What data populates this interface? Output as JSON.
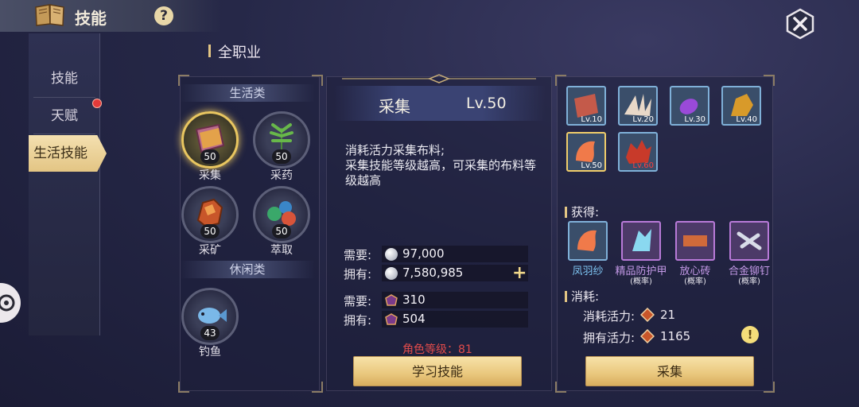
{
  "header": {
    "title": "技能",
    "help_glyph": "?"
  },
  "nav": {
    "items": [
      {
        "label": "技能",
        "has_badge": false
      },
      {
        "label": "天赋",
        "has_badge": true
      },
      {
        "label": "生活技能",
        "active": true
      }
    ]
  },
  "section_title": "全职业",
  "categories": {
    "life": {
      "header": "生活类",
      "skills": [
        {
          "name": "采集",
          "level": "50",
          "icon": "fabric-book-icon",
          "selected": true
        },
        {
          "name": "采药",
          "level": "50",
          "icon": "herb-icon"
        },
        {
          "name": "采矿",
          "level": "50",
          "icon": "ore-icon"
        },
        {
          "name": "萃取",
          "level": "50",
          "icon": "extract-icon"
        }
      ]
    },
    "leisure": {
      "header": "休闲类",
      "skills": [
        {
          "name": "钓鱼",
          "level": "43",
          "icon": "fish-icon"
        }
      ]
    }
  },
  "detail": {
    "name": "采集",
    "level": "Lv.50",
    "description": "消耗活力采集布料;\n采集技能等级越高，可采集的布料等级越高",
    "requirements": [
      {
        "label": "需要:",
        "value": "97,000",
        "icon": "silver-coin-icon"
      },
      {
        "label": "拥有:",
        "value": "7,580,985",
        "icon": "silver-coin-icon",
        "plus": "+"
      },
      {
        "label": "需要:",
        "value": "310",
        "icon": "skill-point-icon"
      },
      {
        "label": "拥有:",
        "value": "504",
        "icon": "skill-point-icon"
      }
    ],
    "role_level": "角色等级：81",
    "learn_button": "学习技能"
  },
  "right": {
    "tiers": [
      {
        "lv": "Lv.10",
        "icon": "red-cloth-icon"
      },
      {
        "lv": "Lv.20",
        "icon": "feather-bundle-icon"
      },
      {
        "lv": "Lv.30",
        "icon": "purple-gem-icon"
      },
      {
        "lv": "Lv.40",
        "icon": "gold-leaf-icon"
      },
      {
        "lv": "Lv.50",
        "icon": "phoenix-feather-icon",
        "selected": true
      },
      {
        "lv": "Lv.60",
        "icon": "spiked-cloth-icon",
        "locked": true
      }
    ],
    "gain_title": "获得:",
    "gains": [
      {
        "name": "凤羽纱",
        "sub": "",
        "rarity": "blue",
        "icon": "phoenix-feather-icon"
      },
      {
        "name": "精品防护甲",
        "sub": "(概率)",
        "rarity": "purple",
        "icon": "crystal-armor-icon"
      },
      {
        "name": "放心砖",
        "sub": "(概率)",
        "rarity": "purple",
        "icon": "brick-icon"
      },
      {
        "name": "合金铆钉",
        "sub": "(概率)",
        "rarity": "purple",
        "icon": "rivet-icon"
      }
    ],
    "cost_title": "消耗:",
    "vitality": [
      {
        "label": "消耗活力:",
        "value": "21"
      },
      {
        "label": "拥有活力:",
        "value": "1165"
      }
    ],
    "warn_glyph": "!",
    "collect_button": "采集"
  },
  "colors": {
    "accent_gold": "#e9c660",
    "rarity_purple": "#b87ad8",
    "rarity_blue": "#7fb0d8",
    "warning_red": "#e04b4b"
  }
}
